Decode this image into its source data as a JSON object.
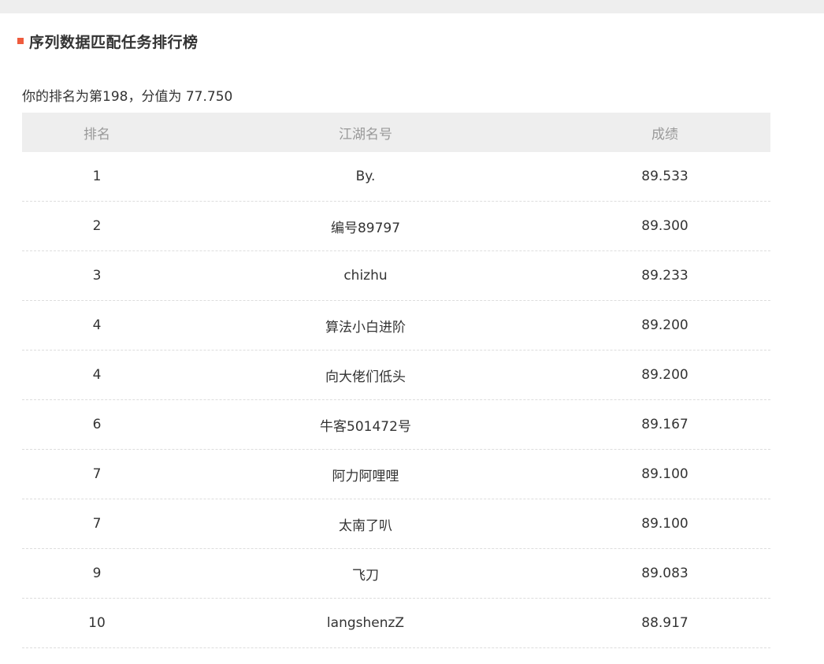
{
  "page": {
    "title": "序列数据匹配任务排行榜",
    "summary": "你的排名为第198，分值为 77.750"
  },
  "colors": {
    "accent": "#ef5b3d",
    "header_bg": "#eeeeee"
  },
  "table": {
    "columns": [
      "排名",
      "江湖名号",
      "成绩"
    ],
    "rows": [
      {
        "rank": "1",
        "name": "By.",
        "score": "89.533"
      },
      {
        "rank": "2",
        "name": "编号89797",
        "score": "89.300"
      },
      {
        "rank": "3",
        "name": "chizhu",
        "score": "89.233"
      },
      {
        "rank": "4",
        "name": "算法小白进阶",
        "score": "89.200"
      },
      {
        "rank": "4",
        "name": "向大佬们低头",
        "score": "89.200"
      },
      {
        "rank": "6",
        "name": "牛客501472号",
        "score": "89.167"
      },
      {
        "rank": "7",
        "name": "阿力阿哩哩",
        "score": "89.100"
      },
      {
        "rank": "7",
        "name": "太南了叭",
        "score": "89.100"
      },
      {
        "rank": "9",
        "name": "飞刀",
        "score": "89.083"
      },
      {
        "rank": "10",
        "name": "langshenzZ",
        "score": "88.917"
      }
    ]
  }
}
